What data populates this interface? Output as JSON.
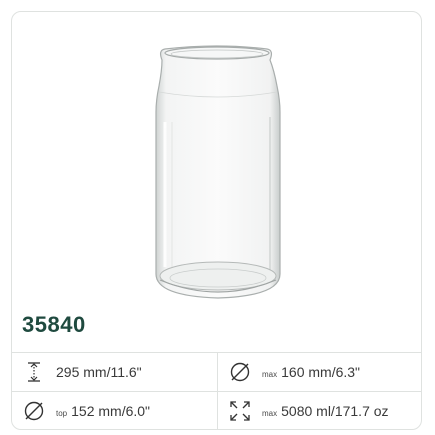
{
  "product": {
    "code": "35840"
  },
  "specs": {
    "height": {
      "icon": "height-icon",
      "value": "295 mm/11.6\""
    },
    "max_diameter": {
      "icon": "diameter-icon",
      "prefix": "max",
      "value": "160 mm/6.3\""
    },
    "top_diameter": {
      "icon": "diameter-icon",
      "prefix": "top",
      "value": "152 mm/6.0\""
    },
    "capacity": {
      "icon": "expand-icon",
      "prefix": "max",
      "value": "5080 ml/171.7 oz"
    }
  },
  "colors": {
    "accent": "#1f4a3f",
    "border": "#dfe2e0",
    "text": "#3a3a3a"
  }
}
